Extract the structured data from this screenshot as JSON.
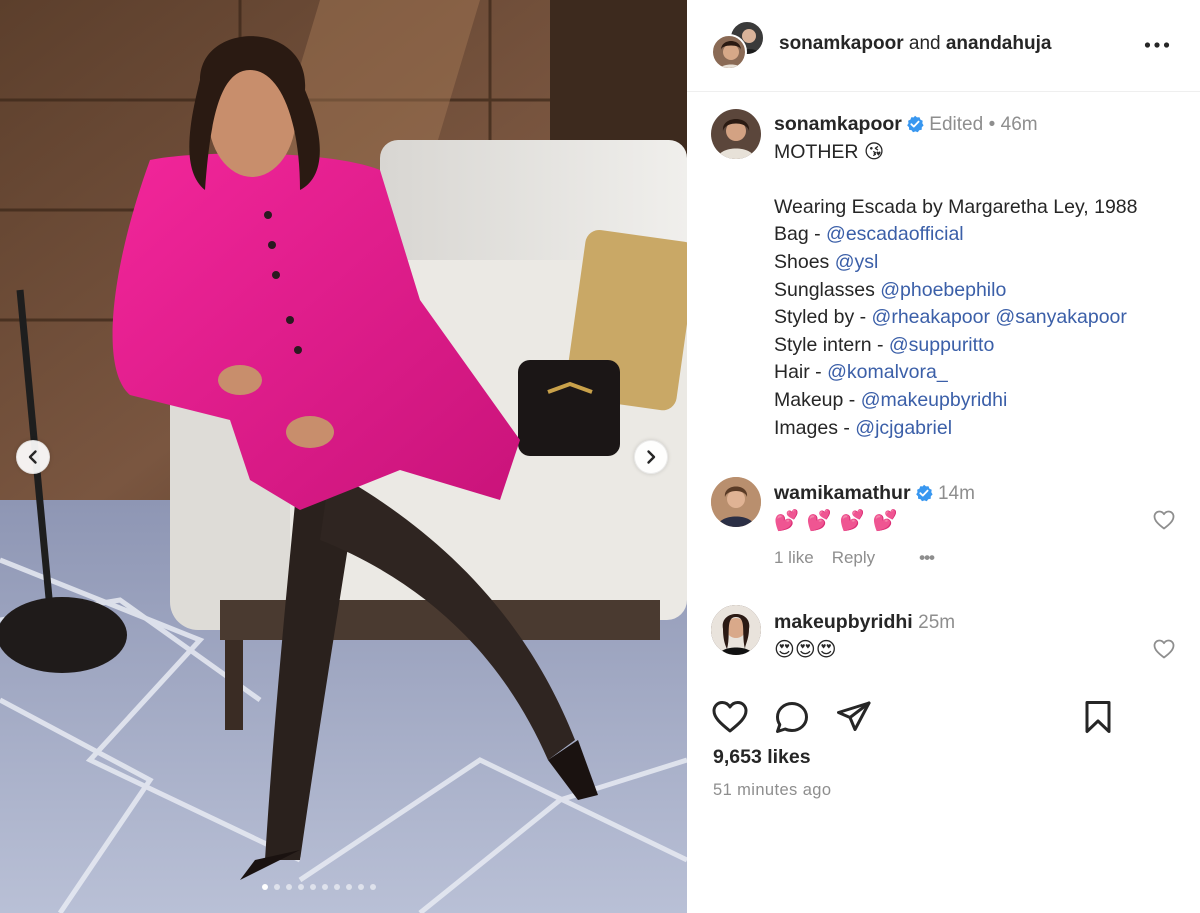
{
  "post": {
    "header": {
      "author": "sonamkapoor",
      "joiner": "and",
      "collaborator": "anandahuja",
      "more_label": "•••"
    },
    "caption": {
      "username": "sonamkapoor",
      "edited": "Edited",
      "separator": "•",
      "time": "46m",
      "lines": {
        "l1": "MOTHER 😘",
        "l2": "Wearing Escada by Margaretha Ley, 1988",
        "l3_prefix": "Bag - ",
        "l3_mention": "@escadaofficial",
        "l4_prefix": "Shoes ",
        "l4_mention": "@ysl",
        "l5_prefix": "Sunglasses ",
        "l5_mention": "@phoebephilo",
        "l6_prefix": "Styled by - ",
        "l6_mention_a": "@rheakapoor",
        "l6_mention_b": "@sanyakapoor",
        "l7_prefix": "Style intern - ",
        "l7_mention": "@suppuritto",
        "l8_prefix": "Hair - ",
        "l8_mention": "@komalvora_",
        "l9_prefix": "Makeup - ",
        "l9_mention": "@makeupbyridhi",
        "l10_prefix": "Images - ",
        "l10_mention": "@jcjgabriel"
      }
    },
    "comments": [
      {
        "username": "wamikamathur",
        "verified": true,
        "time": "14m",
        "text": "💕💕💕💕",
        "likes_label": "1 like",
        "reply_label": "Reply",
        "more_label": "•••"
      },
      {
        "username": "makeupbyridhi",
        "verified": false,
        "time": "25m",
        "text": "😍😍😍"
      }
    ],
    "likes": "9,653 likes",
    "posted": "51 minutes ago",
    "carousel": {
      "count": 10,
      "active": 0
    }
  },
  "colors": {
    "text": "#262626",
    "muted": "#8e8e8e",
    "mention": "#3b5fa8",
    "verified": "#3897f0",
    "heart_pink": "#ff4f8b"
  },
  "icons": [
    "more-icon",
    "verified-icon",
    "heart-icon",
    "comment-icon",
    "share-icon",
    "bookmark-icon",
    "chevron-left-icon",
    "chevron-right-icon"
  ]
}
